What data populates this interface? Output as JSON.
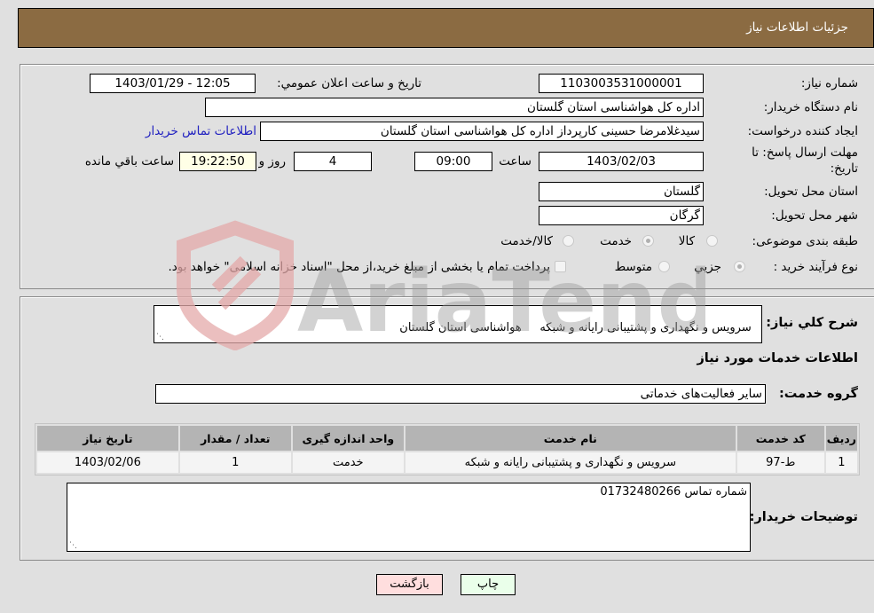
{
  "header": {
    "title": "جزئیات اطلاعات نیاز"
  },
  "form": {
    "need_number": {
      "label": "شماره نیاز:",
      "value": "1103003531000001"
    },
    "announce_datetime": {
      "label": "تاریخ و ساعت اعلان عمومي:",
      "value": "1403/01/29 - 12:05"
    },
    "buyer_org": {
      "label": "نام دستگاه خریدار:",
      "value": "اداره کل هواشناسی استان گلستان"
    },
    "creator": {
      "label": "ایجاد کننده درخواست:",
      "value": "سیدغلامرضا حسینی کارپرداز اداره کل هواشناسی استان گلستان"
    },
    "buyer_contact_link": "اطلاعات تماس خریدار",
    "deadline": {
      "label_line1": "مهلت ارسال پاسخ: تا",
      "label_line2": "تاریخ:",
      "date": "1403/02/03",
      "time_label": "ساعت",
      "time": "09:00",
      "days": "4",
      "days_label": "روز و",
      "remaining": "19:22:50",
      "remaining_label": "ساعت باقي مانده"
    },
    "delivery_province": {
      "label": "استان محل تحویل:",
      "value": "گلستان"
    },
    "delivery_city": {
      "label": "شهر محل تحویل:",
      "value": "گرگان"
    },
    "category": {
      "label": "طبقه بندی موضوعی:",
      "options": [
        {
          "label": "کالا",
          "selected": false
        },
        {
          "label": "خدمت",
          "selected": true
        },
        {
          "label": "کالا/خدمت",
          "selected": false
        }
      ]
    },
    "purchase_type": {
      "label": "نوع فرآیند خرید :",
      "options": [
        {
          "label": "جزيي",
          "selected": true
        },
        {
          "label": "متوسط",
          "selected": false
        }
      ],
      "treasury_checkbox_label": "پرداخت تمام یا بخشی از مبلغ خرید،از محل \"اسناد خزانه اسلامی\" خواهد بود.",
      "treasury_checked": false
    }
  },
  "details": {
    "summary_label": "شرح کلي نیاز:",
    "summary_value": "سرویس و نگهداری و پشتیبانی رایانه و شبکه     هواشناسی استان گلستان",
    "services_title": "اطلاعات خدمات مورد نیاز",
    "service_group_label": "گروه خدمت:",
    "service_group_value": "سایر فعالیت‌های خدماتی",
    "table": {
      "headers": [
        "ردیف",
        "کد خدمت",
        "نام خدمت",
        "واحد اندازه گیری",
        "تعداد / مقدار",
        "تاریخ نیاز"
      ],
      "rows": [
        [
          "1",
          "ط-97",
          "سرویس و نگهداری و پشتیبانی رایانه و شبکه",
          "خدمت",
          "1",
          "1403/02/06"
        ]
      ]
    },
    "buyer_notes_label": "توضیحات خریدار:",
    "buyer_notes_value": "شماره تماس 01732480266"
  },
  "buttons": {
    "print": "چاپ",
    "back": "بازگشت"
  },
  "colors": {
    "header_bg": "#8b6b42",
    "link": "#2020c0",
    "print_bg": "#eaffea",
    "back_bg": "#ffdede"
  },
  "watermark": {
    "text": "AriaTender.neT"
  }
}
